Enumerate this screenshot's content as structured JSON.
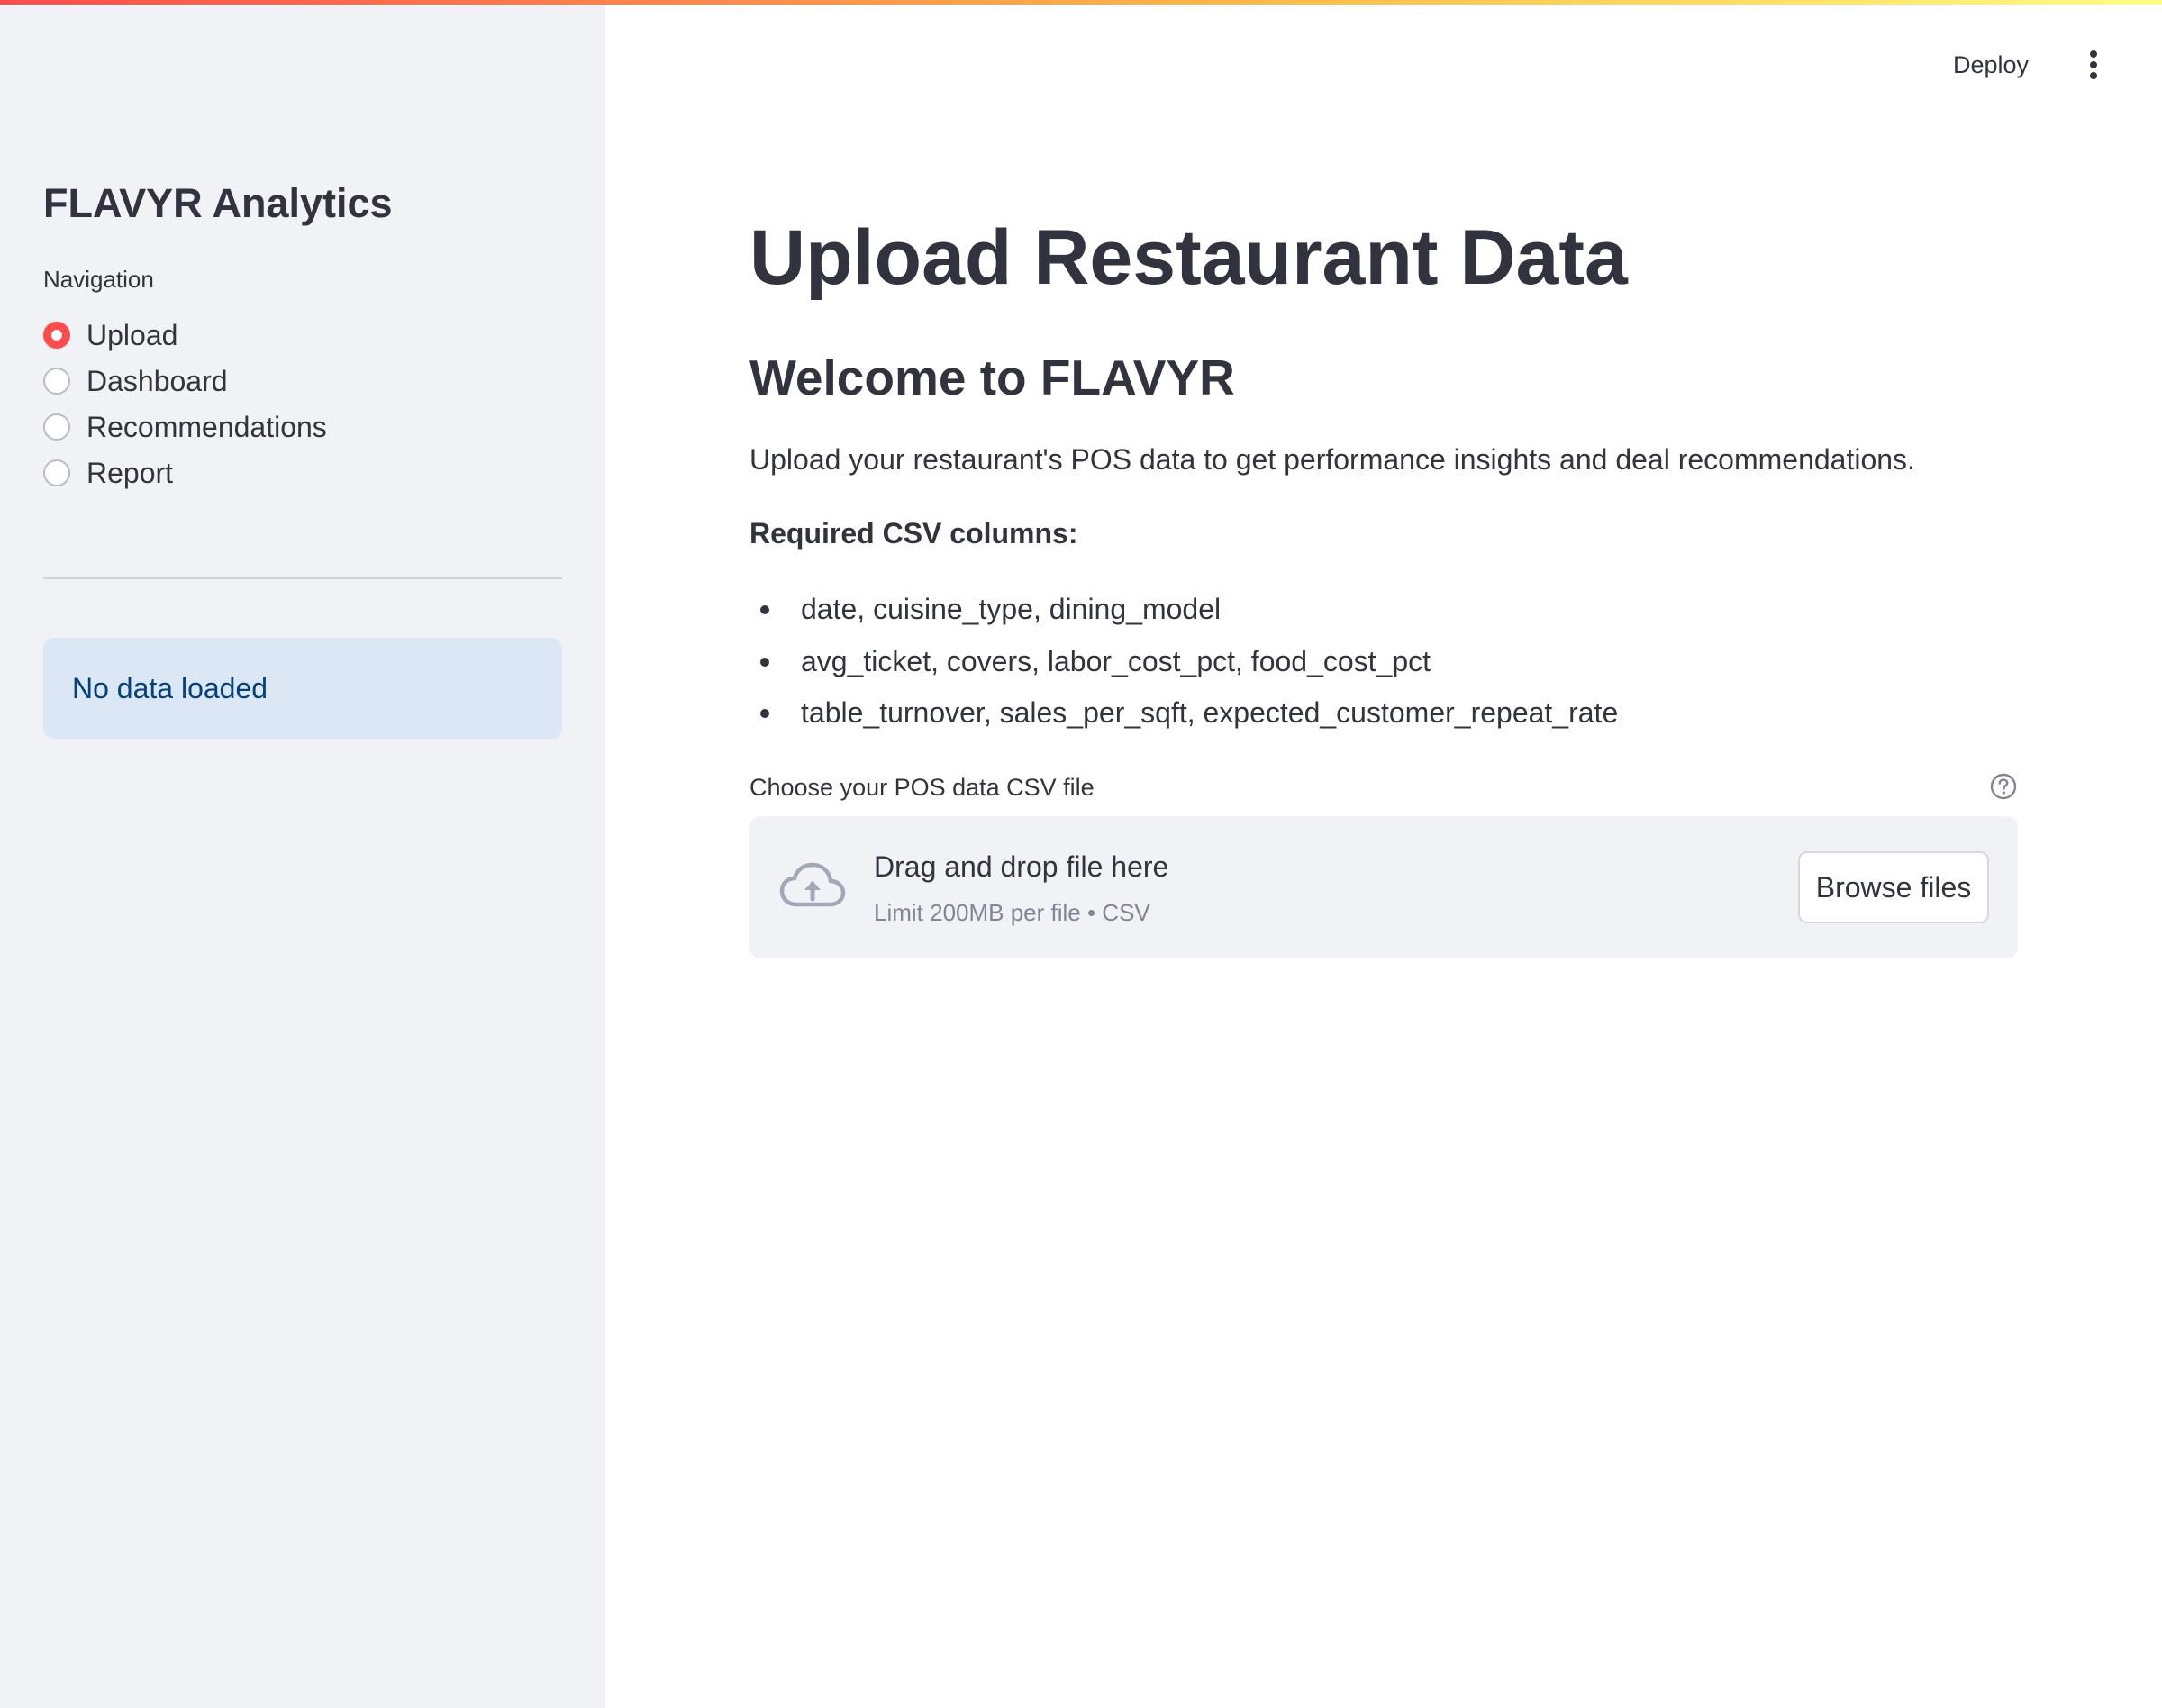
{
  "colors": {
    "accent": "#ff4b4b",
    "sidebar_bg": "#f0f2f6",
    "info_bg": "#dbe7f5",
    "info_text": "#004280",
    "text": "#31333f",
    "muted": "#808495"
  },
  "sidebar": {
    "title": "FLAVYR Analytics",
    "nav_label": "Navigation",
    "nav_items": [
      {
        "label": "Upload",
        "selected": true
      },
      {
        "label": "Dashboard",
        "selected": false
      },
      {
        "label": "Recommendations",
        "selected": false
      },
      {
        "label": "Report",
        "selected": false
      }
    ],
    "status_message": "No data loaded"
  },
  "toolbar": {
    "deploy_label": "Deploy",
    "menu_icon": "kebab-menu-icon"
  },
  "main": {
    "title": "Upload Restaurant Data",
    "subtitle": "Welcome to FLAVYR",
    "intro": "Upload your restaurant's POS data to get performance insights and deal recommendations.",
    "required_label": "Required CSV columns:",
    "required_columns": [
      "date, cuisine_type, dining_model",
      "avg_ticket, covers, labor_cost_pct, food_cost_pct",
      "table_turnover, sales_per_sqft, expected_customer_repeat_rate"
    ],
    "uploader": {
      "label": "Choose your POS data CSV file",
      "help_icon": "help-circle-icon",
      "dropzone_title": "Drag and drop file here",
      "dropzone_limit": "Limit 200MB per file • CSV",
      "browse_label": "Browse files",
      "upload_icon": "cloud-upload-icon"
    }
  }
}
